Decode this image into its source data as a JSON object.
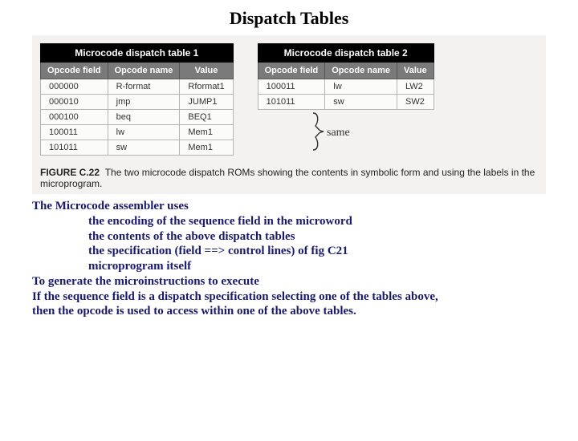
{
  "title": "Dispatch Tables",
  "table1": {
    "title": "Microcode dispatch table 1",
    "headers": [
      "Opcode field",
      "Opcode name",
      "Value"
    ],
    "rows": [
      [
        "000000",
        "R-format",
        "Rformat1"
      ],
      [
        "000010",
        "jmp",
        "JUMP1"
      ],
      [
        "000100",
        "beq",
        "BEQ1"
      ],
      [
        "100011",
        "lw",
        "Mem1"
      ],
      [
        "101011",
        "sw",
        "Mem1"
      ]
    ]
  },
  "table2": {
    "title": "Microcode dispatch table 2",
    "headers": [
      "Opcode field",
      "Opcode name",
      "Value"
    ],
    "rows": [
      [
        "100011",
        "lw",
        "LW2"
      ],
      [
        "101011",
        "sw",
        "SW2"
      ]
    ]
  },
  "annotation": "same",
  "caption_label": "FIGURE C.22",
  "caption_text": "The two microcode dispatch ROMs showing the contents in symbolic form and using the labels in the microprogram.",
  "notes": {
    "line1": "The Microcode assembler uses",
    "bullet1": "the encoding of the sequence field in the microword",
    "bullet2": "the contents of the above dispatch tables",
    "bullet3": "the specification (field ==> control lines) of fig C21",
    "bullet4": "microprogram itself",
    "line2": "To generate the microinstructions to execute",
    "line3": "If the sequence field is a dispatch specification selecting one of the tables above,",
    "line4": "then the opcode is used to access within one of the above tables."
  }
}
